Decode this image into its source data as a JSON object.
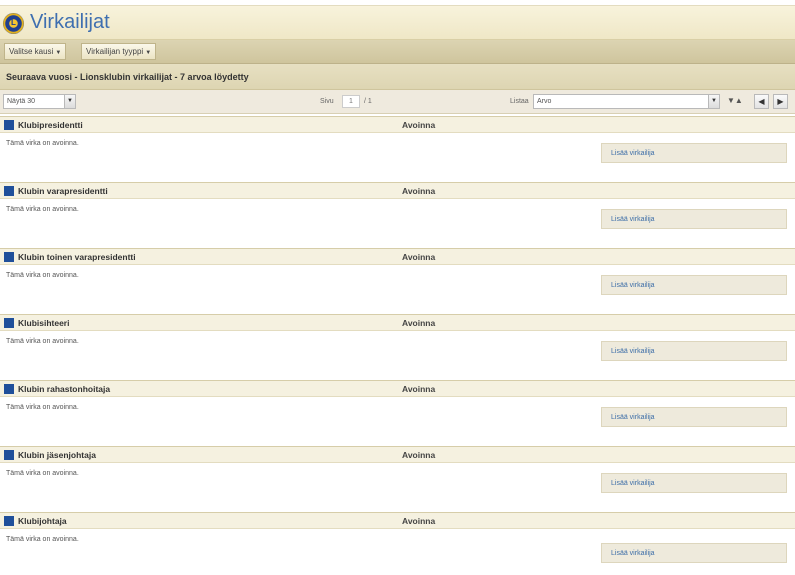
{
  "header": {
    "title": "Virkailijat",
    "logo_icon": "lions-logo-icon"
  },
  "toolbar": {
    "season_label": "Valitse kausi",
    "type_label": "Virkailijan tyyppi"
  },
  "results": {
    "text": "Seuraava vuosi - Lionsklubin virkailijat - 7 arvoa löydetty"
  },
  "pager": {
    "show_value": "Näytä 30",
    "page_label": "Sivu",
    "page_current": "1",
    "page_total": "/ 1",
    "sort_label": "Listaa",
    "sort_value": "Arvo"
  },
  "offices": [
    {
      "role": "Klubipresidentti",
      "status": "Avoinna",
      "description": "Tämä virka on avoinna.",
      "action": "Lisää virkailija"
    },
    {
      "role": "Klubin varapresidentti",
      "status": "Avoinna",
      "description": "Tämä virka on avoinna.",
      "action": "Lisää virkailija"
    },
    {
      "role": "Klubin toinen varapresidentti",
      "status": "Avoinna",
      "description": "Tämä virka on avoinna.",
      "action": "Lisää virkailija"
    },
    {
      "role": "Klubisihteeri",
      "status": "Avoinna",
      "description": "Tämä virka on avoinna.",
      "action": "Lisää virkailija"
    },
    {
      "role": "Klubin rahastonhoitaja",
      "status": "Avoinna",
      "description": "Tämä virka on avoinna.",
      "action": "Lisää virkailija"
    },
    {
      "role": "Klubin jäsenjohtaja",
      "status": "Avoinna",
      "description": "Tämä virka on avoinna.",
      "action": "Lisää virkailija"
    },
    {
      "role": "Klubijohtaja",
      "status": "Avoinna",
      "description": "Tämä virka on avoinna.",
      "action": "Lisää virkailija"
    }
  ],
  "colors": {
    "accent": "#3f6fb0",
    "header_bg": "#f3edd2",
    "role_icon": "#1f4f9a"
  }
}
